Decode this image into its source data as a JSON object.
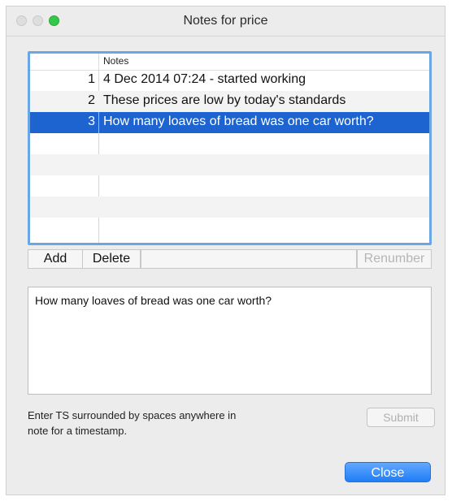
{
  "window": {
    "title": "Notes for price"
  },
  "table": {
    "header_notes": "Notes",
    "rows": [
      {
        "num": "1",
        "note": "4 Dec 2014 07:24 - started working"
      },
      {
        "num": "2",
        "note": "These prices are low by today's standards"
      },
      {
        "num": "3",
        "note": "How many loaves of bread was one car worth?"
      }
    ],
    "selected_row": "3"
  },
  "buttons": {
    "add": "Add",
    "delete": "Delete",
    "renumber": "Renumber",
    "submit": "Submit",
    "close": "Close"
  },
  "editor": {
    "value": "How many loaves of bread was one car worth?"
  },
  "hint": {
    "line1": "Enter TS surrounded by spaces anywhere in",
    "line2": "note for a timestamp."
  },
  "colors": {
    "selection": "#1d64d0",
    "focus_ring": "#6aa6e6",
    "zoom_button": "#34c84a",
    "close_button": "#1f7ef5"
  }
}
